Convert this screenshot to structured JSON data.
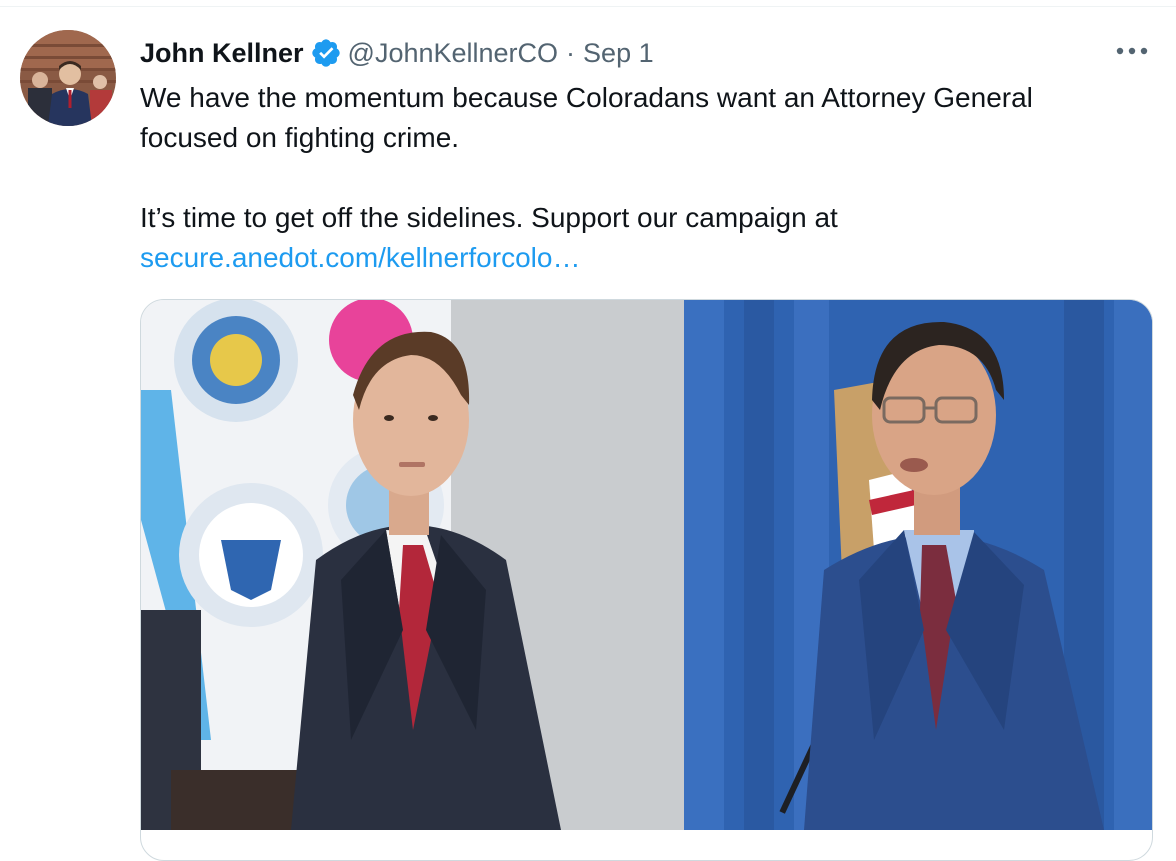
{
  "tweet": {
    "display_name": "John Kellner",
    "verified": true,
    "handle": "@JohnKellnerCO",
    "separator": "·",
    "date": "Sep 1",
    "text_line_1": "We have the momentum because Coloradans want an Attorney General",
    "text_line_2": "focused on fighting crime.",
    "text_line_3": "It’s time to get off the sidelines. Support our campaign at",
    "link_text": "secure.anedot.com/kellnerforcolo…"
  },
  "icons": {
    "verified": "verified-badge-icon",
    "more": "more-options-icon"
  },
  "colors": {
    "text_primary": "#0f1419",
    "text_secondary": "#536471",
    "link": "#1d9bf0",
    "verified_badge": "#1d9bf0",
    "border": "#cfd9de"
  }
}
